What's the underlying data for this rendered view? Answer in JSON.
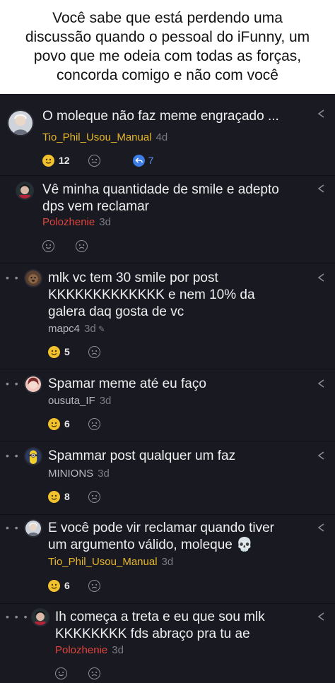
{
  "caption": {
    "line1": "Você sabe que está perdendo uma",
    "line2": "discussão quando o pessoal do iFunny, um",
    "line3": "povo que me odeia com todas as forças,",
    "line4": "concorda comigo e não com você"
  },
  "colors": {
    "background": "#15151c",
    "username_yellow": "#e7b72a",
    "username_red": "#e2443e",
    "username_grey": "#b8b8c2",
    "smile_active": "#f2c12e",
    "reply_blue": "#3d7de6"
  },
  "comments": [
    {
      "text": "O moleque não faz meme engraçado ...",
      "username": "Tio_Phil_Usou_Manual",
      "time": "4d",
      "smiles": "12",
      "replies": "7",
      "avatar_icon": "old-man-avatar-icon"
    },
    {
      "dots": "•",
      "text_line1": "Vê minha quantidade de smile e adepto",
      "text_line2": "dps vem reclamar",
      "username": "Polozhenie",
      "time": "3d",
      "avatar_icon": "anime-character-avatar-icon"
    },
    {
      "dots": "• •",
      "text_line1": "mlk vc tem 30 smile por post",
      "text_line2": "KKKKKKKKKKKKK e nem 10% da",
      "text_line3": "galera daq gosta de vc",
      "username": "mapc4",
      "time": "3d",
      "smiles": "5",
      "avatar_icon": "dog-avatar-icon"
    },
    {
      "dots": "• •",
      "text": "Spamar meme até eu faço",
      "username": "ousuta_IF",
      "time": "3d",
      "smiles": "6",
      "avatar_icon": "anime-girl-avatar-icon"
    },
    {
      "dots": "• •",
      "text": "Spammar post qualquer um faz",
      "username": "MINIONS",
      "time": "3d",
      "smiles": "8",
      "avatar_icon": "minion-avatar-icon"
    },
    {
      "dots": "• •",
      "text_line1": "E você pode vir reclamar quando tiver",
      "text_line2": "um argumento válido, moleque 💀",
      "username": "Tio_Phil_Usou_Manual",
      "time": "3d",
      "smiles": "6",
      "avatar_icon": "old-man-avatar-icon"
    },
    {
      "dots": "• • •",
      "text_line1": "Ih começa a treta e eu que sou mlk",
      "text_line2": "KKKKKKKK fds abraço pra tu ae",
      "username": "Polozhenie",
      "time": "3d",
      "avatar_icon": "anime-character-avatar-icon"
    }
  ]
}
